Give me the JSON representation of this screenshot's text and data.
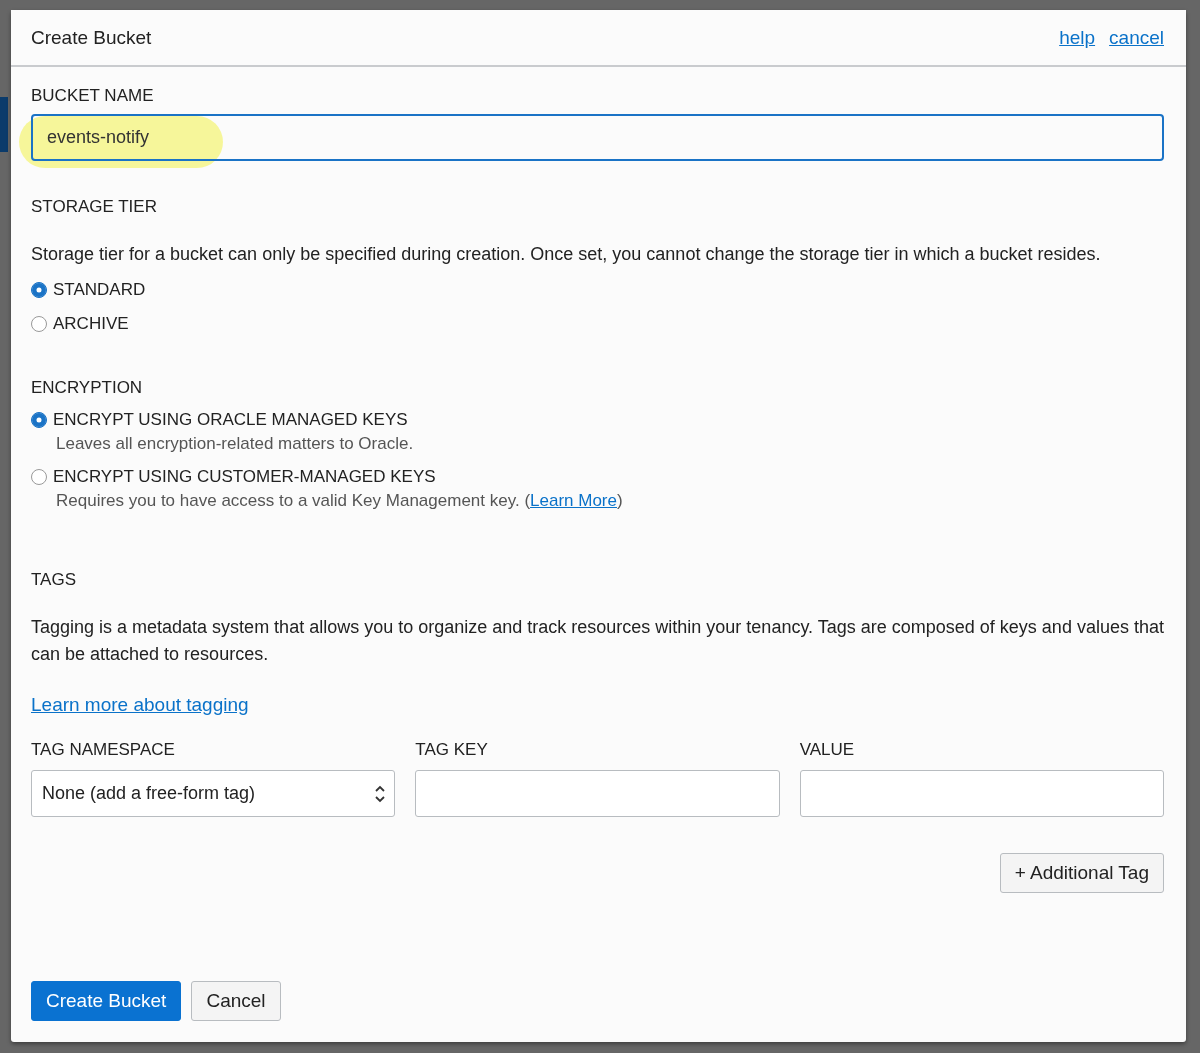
{
  "dialog": {
    "title": "Create Bucket",
    "header_links": [
      "help",
      "cancel"
    ]
  },
  "bucket_name": {
    "label": "BUCKET NAME",
    "value": "events-notify",
    "highlighted": true
  },
  "storage_tier": {
    "label": "STORAGE TIER",
    "description": "Storage tier for a bucket can only be specified during creation. Once set, you cannot change the storage tier in which a bucket resides.",
    "options": [
      {
        "label": "STANDARD",
        "selected": true
      },
      {
        "label": "ARCHIVE",
        "selected": false
      }
    ]
  },
  "encryption": {
    "label": "ENCRYPTION",
    "options": [
      {
        "label": "ENCRYPT USING ORACLE MANAGED KEYS",
        "selected": true,
        "description": "Leaves all encryption-related matters to Oracle."
      },
      {
        "label": "ENCRYPT USING CUSTOMER-MANAGED KEYS",
        "selected": false,
        "description": "Requires you to have access to a valid Key Management key. (",
        "link": "Learn More",
        "description_end": ")"
      }
    ]
  },
  "tags": {
    "label": "TAGS",
    "description": "Tagging is a metadata system that allows you to organize and track resources within your tenancy. Tags are composed of keys and values that can be attached to resources.",
    "link": "Learn more about tagging",
    "columns": [
      {
        "label": "TAG NAMESPACE",
        "kind": "select",
        "value": "None (add a free-form tag)"
      },
      {
        "label": "TAG KEY",
        "kind": "input"
      },
      {
        "label": "VALUE",
        "kind": "input"
      }
    ],
    "add_button": "+ Additional Tag"
  },
  "buttons": [
    {
      "label": "Create Bucket",
      "kind": "primary"
    },
    {
      "label": "Cancel",
      "kind": "secondary"
    }
  ]
}
